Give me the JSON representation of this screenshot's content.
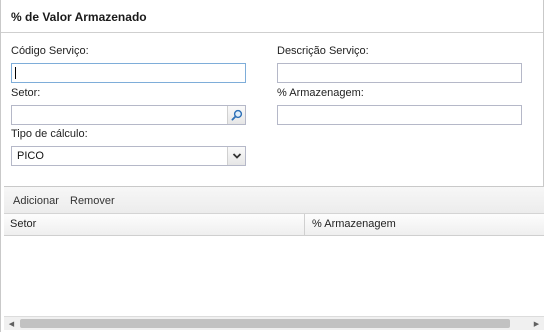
{
  "panel": {
    "title": "% de Valor Armazenado"
  },
  "form": {
    "codigo_label": "Código Serviço:",
    "codigo_value": "",
    "descricao_label": "Descrição Serviço:",
    "descricao_value": "",
    "setor_label": "Setor:",
    "setor_value": "",
    "armazenagem_label": "% Armazenagem:",
    "armazenagem_value": "",
    "tipo_label": "Tipo de cálculo:",
    "tipo_value": "PICO"
  },
  "toolbar": {
    "add_label": "Adicionar",
    "remove_label": "Remover"
  },
  "grid": {
    "columns": [
      "Setor",
      "% Armazenagem"
    ],
    "rows": []
  },
  "icons": {
    "search": "search-icon",
    "dropdown": "chevron-down-icon"
  },
  "colors": {
    "focus_border": "#7eadd9",
    "field_border": "#b5b8c8"
  }
}
